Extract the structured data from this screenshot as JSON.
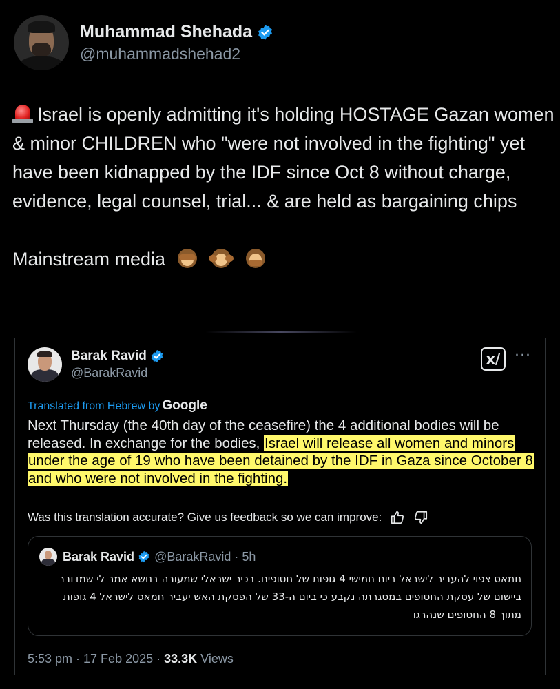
{
  "author": {
    "name": "Muhammad Shehada",
    "handle": "@muhammadshehad2",
    "verified": true
  },
  "tweet": {
    "siren_icon": "police-light-emoji",
    "text": "Israel is openly admitting it's holding HOSTAGE Gazan women & minor CHILDREN who \"were not involved in the fighting\" yet have been kidnapped by the IDF since Oct 8 without charge, evidence, legal counsel, trial... & are held as bargaining chips",
    "text2": "Mainstream media",
    "monkey_icons": [
      "see-no-evil-monkey",
      "hear-no-evil-monkey",
      "speak-no-evil-monkey"
    ]
  },
  "embedded": {
    "name": "Barak Ravid",
    "handle": "@BarakRavid",
    "grok_label": "x/",
    "more_label": "···",
    "translated_prefix": "Translated from Hebrew by",
    "translated_provider": "Google",
    "text_plain": "Next Thursday (the 40th day of the ceasefire) the 4 additional bodies will be released. In exchange for the bodies, ",
    "text_highlight": "Israel will release all women and minors under the age of 19 who have been detained by the IDF in Gaza since October 8 and who were not involved in the fighting.",
    "feedback": "Was this translation accurate? Give us feedback so we can improve:",
    "quote": {
      "name": "Barak Ravid",
      "handle": "@BarakRavid · 5h",
      "text": "חמאס צפוי להעביר לישראל ביום חמישי 4 גופות של חטופים. בכיר ישראלי שמעורה בנושא אמר לי שמדובר ביישום של עסקת החטופים במסגרתה נקבע כי ביום ה-33 של הפסקת האש יעביר חמאס לישראל 4 גופות מתוך 8 החטופים שנהרגו"
    },
    "time": "5:53 pm · 17 Feb 2025 · ",
    "views_count": "33.3K",
    "views_label": " Views"
  },
  "colors": {
    "background": "#000000",
    "text": "#e7e9ea",
    "muted": "#8b98a5",
    "link": "#1d9bf0",
    "highlight": "#fff86b",
    "verified": "#1d9bf0"
  }
}
